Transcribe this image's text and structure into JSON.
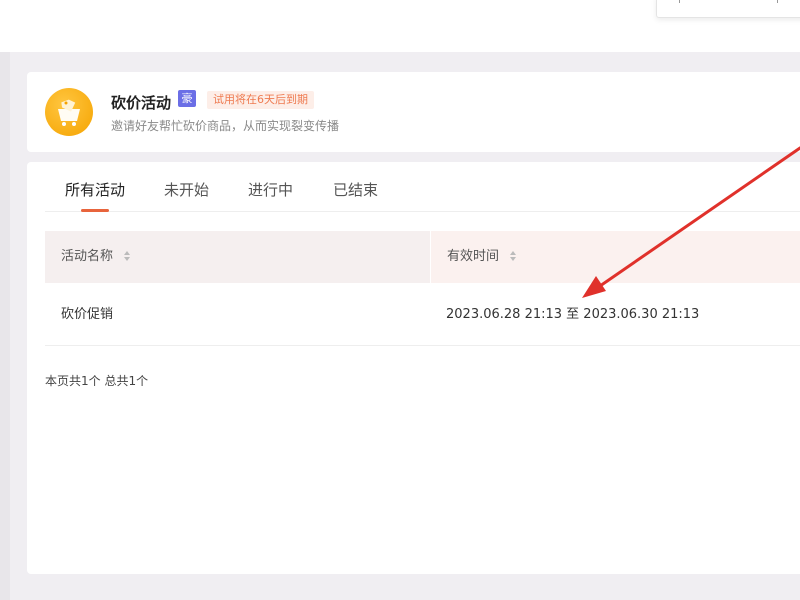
{
  "header": {
    "title": "砍价活动",
    "vip_badge": "豪",
    "trial_notice": "试用将在6天后到期",
    "description": "邀请好友帮忙砍价商品，从而实现裂变传播",
    "icon": "shopping-cart-tag-icon",
    "icon_color": "#f5a300"
  },
  "tabs": [
    {
      "label": "所有活动",
      "active": true
    },
    {
      "label": "未开始",
      "active": false
    },
    {
      "label": "进行中",
      "active": false
    },
    {
      "label": "已结束",
      "active": false
    }
  ],
  "table": {
    "columns": [
      "活动名称",
      "有效时间"
    ],
    "rows": [
      {
        "name": "砍价促销",
        "time": "2023.06.28 21:13 至 2023.06.30 21:13"
      }
    ]
  },
  "pagination": {
    "summary": "本页共1个 总共1个"
  },
  "colors": {
    "accent": "#e8643c",
    "vip_badge": "#6b6ee6",
    "trial_text": "#ee7a50",
    "annotation_arrow": "#e0312b"
  }
}
